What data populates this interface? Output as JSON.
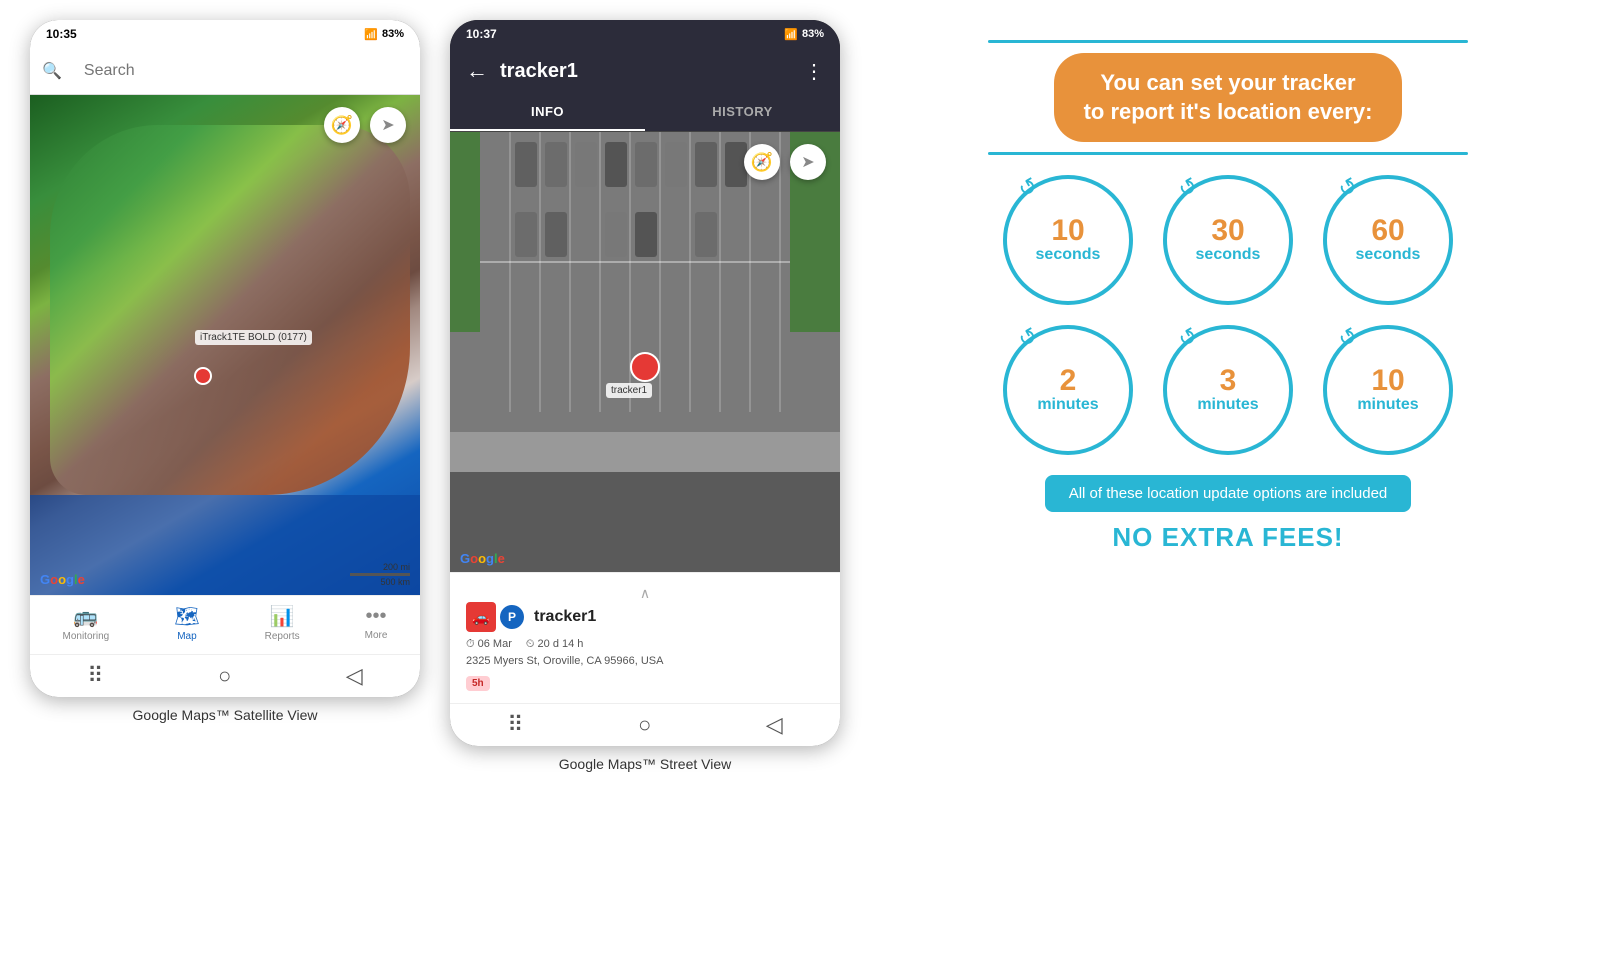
{
  "phone1": {
    "status_time": "10:35",
    "status_battery": "83%",
    "search_placeholder": "Search",
    "tracker_label": "iTrack1TE BOLD (0177)",
    "google_logo": "Google",
    "scale_200mi": "200 mi",
    "scale_500km": "500 km",
    "nav_items": [
      {
        "label": "Monitoring",
        "icon": "🚌",
        "active": false
      },
      {
        "label": "Map",
        "icon": "🗺",
        "active": true
      },
      {
        "label": "Reports",
        "icon": "📊",
        "active": false
      },
      {
        "label": "More",
        "icon": "•••",
        "active": false
      }
    ],
    "bottom_btns": [
      "⠿",
      "○",
      "◁"
    ]
  },
  "phone2": {
    "status_time": "10:37",
    "status_battery": "83%",
    "title": "tracker1",
    "tab_info": "INFO",
    "tab_history": "HISTORY",
    "tracker_name": "tracker1",
    "date": "06 Mar",
    "duration": "20 d 14 h",
    "address": "2325 Myers St, Oroville, CA 95966, USA",
    "badge": "5h",
    "google_logo": "Google",
    "bottom_btns": [
      "⠿",
      "○",
      "◁"
    ]
  },
  "info_panel": {
    "headline_line1": "You can set your tracker",
    "headline_line2": "to report it's location every:",
    "circles": [
      {
        "number": "10",
        "unit": "seconds"
      },
      {
        "number": "30",
        "unit": "seconds"
      },
      {
        "number": "60",
        "unit": "seconds"
      },
      {
        "number": "2",
        "unit": "minutes"
      },
      {
        "number": "3",
        "unit": "minutes"
      },
      {
        "number": "10",
        "unit": "minutes"
      }
    ],
    "no_fees_label": "All of these location update options are included",
    "no_fees_bold": "NO EXTRA FEES!",
    "accent_color": "#e8923b",
    "blue_color": "#29b6d4"
  },
  "captions": {
    "phone1_caption": "Google Maps™ Satellite View",
    "phone2_caption": "Google Maps™ Street View"
  }
}
